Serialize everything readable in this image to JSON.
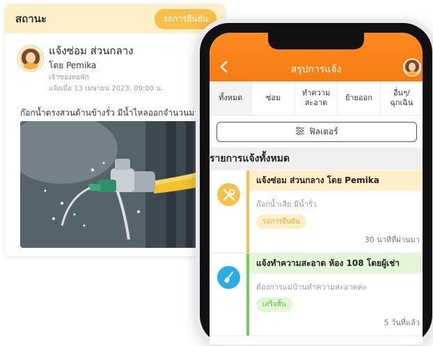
{
  "detail": {
    "status_label": "สถานะ",
    "status_badge": "รอการยืนยัน",
    "title": "แจ้งซ่อม ส่วนกลาง",
    "by": "โดย Pemika",
    "role": "เจ้าของหอพัก",
    "date": "แจ้งเมื่อ 13 เมษายน 2023, 09:00 น.",
    "description": "ก๊อกน้ำตรงสวนด้านข้างรั่ว มีน้ำไหลออกจำนวนมาก",
    "photo_icon": "leaking-faucet-photo"
  },
  "app": {
    "title": "สรุปการแจ้ง",
    "back_icon": "chevron-left-icon",
    "tabs": [
      {
        "label": "ทั้งหมด",
        "active": true
      },
      {
        "label": "ซ่อม",
        "active": false
      },
      {
        "label": "ทำความ\nสะอาด",
        "active": false
      },
      {
        "label": "ย้ายออก",
        "active": false
      },
      {
        "label": "อื่นๆ/\nฉุกเฉิน",
        "active": false
      }
    ],
    "filter_label": "ฟิลเตอร์",
    "section_title": "รายการแจ้งทั้งหมด",
    "items": [
      {
        "title": "แจ้งซ่อม ส่วนกลาง โดย Pemika",
        "desc": "ก๊อกน้ำเสีย มีน้ำรั่ว",
        "status": "รอการยืนยัน",
        "time": "30 นาทีที่ผ่านมา",
        "icon": "wrench-screwdriver-icon",
        "accent": "#f7c04a",
        "head_bg": "#fdf0c8",
        "pill_bg": "#fdf0c8",
        "pill_fg": "#f0a830"
      },
      {
        "title": "แจ้งทำความสะอาด ห้อง 108 โดยผู้เช่า",
        "desc": "ต้องการแม่บ้านทำความสะอาดค่ะ",
        "status": "เสร็จสิ้น",
        "time": "5 วันที่แล้ว",
        "icon": "broom-icon",
        "accent": "#6fce4f",
        "head_bg": "#e3f6d8",
        "pill_bg": "#e3f6d8",
        "pill_fg": "#5cbf3c"
      }
    ]
  }
}
